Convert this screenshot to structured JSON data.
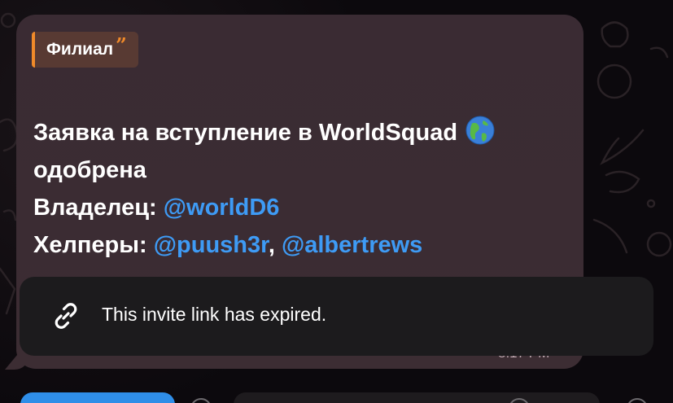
{
  "message": {
    "reply_quote": "Филиал",
    "lines": {
      "line1": "Заявка на вступление в WorldSquad",
      "line2": "одобрена",
      "owner_label": "Владелец:",
      "owner_handle": "@worldD6",
      "helpers_label": "Хелперы:",
      "helper1": "@puush3r",
      "separator": ",",
      "helper2": "@albertrews"
    },
    "globe_icon": "globe-americas-emoji",
    "timestamp": "8:17 PM"
  },
  "toast": {
    "icon": "link-icon",
    "text": "This invite link has expired."
  },
  "colors": {
    "bubble": "#3b2c33",
    "quote_accent": "#f08a2a",
    "mention": "#3e9bf5",
    "toast_bg": "#1c1b1d",
    "primary_button": "#2f8ee8"
  }
}
